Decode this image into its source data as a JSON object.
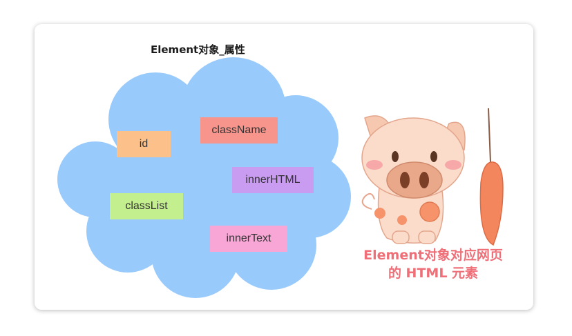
{
  "diagram": {
    "title": "Element对象_属性",
    "properties": [
      {
        "label": "id",
        "color": "#fcc08a"
      },
      {
        "label": "className",
        "color": "#f7948c"
      },
      {
        "label": "innerHTML",
        "color": "#c99cf2"
      },
      {
        "label": "classList",
        "color": "#c3ef8f"
      },
      {
        "label": "innerText",
        "color": "#f8a6d6"
      }
    ],
    "cloud_color": "#99cafc",
    "caption": {
      "line1": "Element对象对应网页",
      "line2": "的 HTML 元素",
      "color": "#ee6f78"
    }
  }
}
